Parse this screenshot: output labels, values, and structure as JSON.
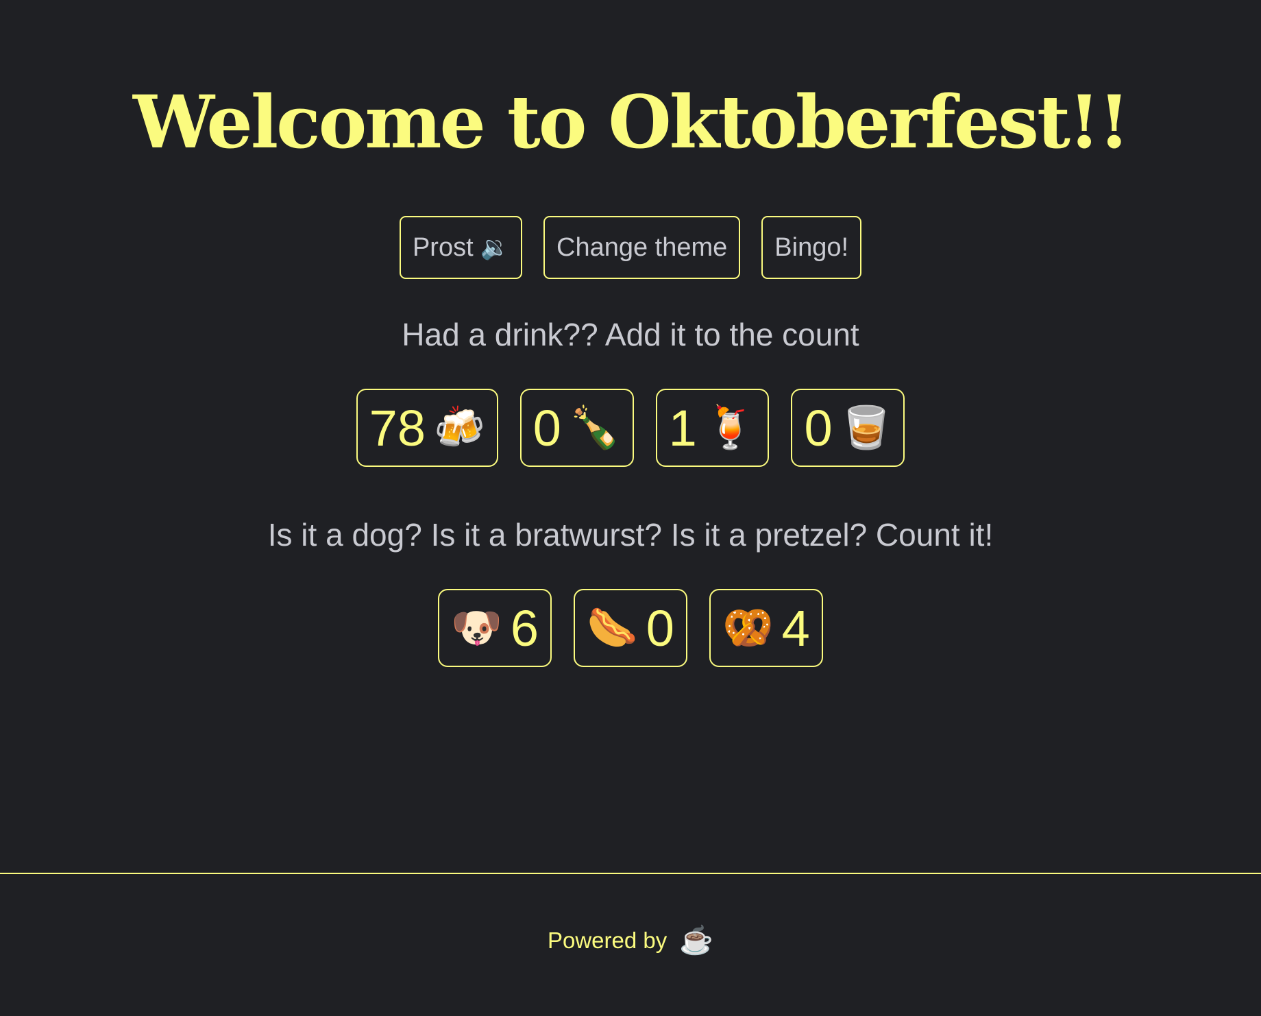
{
  "header": {
    "title": "Welcome to Oktoberfest!!"
  },
  "actions": [
    {
      "label": "Prost",
      "icon": "speaker-icon",
      "glyph": "🔉"
    },
    {
      "label": "Change theme"
    },
    {
      "label": "Bingo!"
    }
  ],
  "drinks": {
    "prompt": "Had a drink?? Add it to the count",
    "counters": [
      {
        "name": "beer",
        "count": "78",
        "emoji": "🍻",
        "icon": "beer-mugs-icon"
      },
      {
        "name": "champagne",
        "count": "0",
        "emoji": "🍾",
        "icon": "champagne-bottle-icon"
      },
      {
        "name": "cocktail",
        "count": "1",
        "emoji": "🍹",
        "icon": "tropical-drink-icon"
      },
      {
        "name": "whisky",
        "count": "0",
        "emoji": "🥃",
        "icon": "tumbler-glass-icon"
      }
    ]
  },
  "food": {
    "prompt": "Is it a dog? Is it a bratwurst? Is it a pretzel? Count it!",
    "counters": [
      {
        "name": "dog",
        "count": "6",
        "emoji": "🐶",
        "icon": "dog-icon"
      },
      {
        "name": "bratwurst",
        "count": "0",
        "emoji": "🌭",
        "icon": "hotdog-icon"
      },
      {
        "name": "pretzel",
        "count": "4",
        "emoji": "🥨",
        "icon": "pretzel-icon"
      }
    ]
  },
  "footer": {
    "text": "Powered by",
    "emoji": "☕",
    "icon": "coffee-icon"
  },
  "colors": {
    "background": "#1f2024",
    "accent": "#fbfb7f",
    "text": "#c9cad1"
  }
}
